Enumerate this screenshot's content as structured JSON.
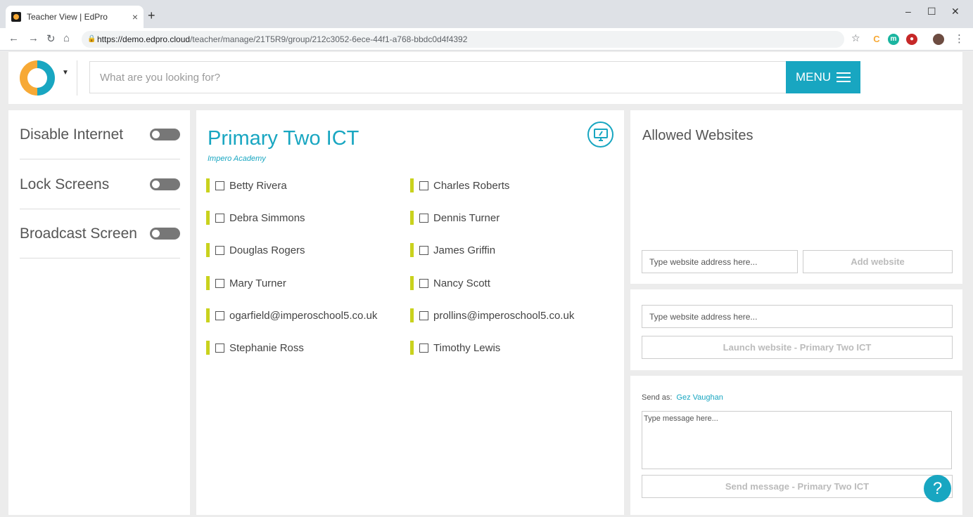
{
  "browser": {
    "tab_title": "Teacher View | EdPro",
    "tab_close": "×",
    "new_tab": "+",
    "url_domain": "https://demo.edpro.cloud",
    "url_path": "/teacher/manage/21T5R9/group/212c3052-6ece-44f1-a768-bbdc0d4f4392",
    "window_minimize": "–",
    "window_maximize": "☐",
    "window_close": "✕"
  },
  "header": {
    "search_placeholder": "What are you looking for?",
    "menu_label": "MENU"
  },
  "controls": [
    {
      "label": "Disable Internet",
      "on": false
    },
    {
      "label": "Lock Screens",
      "on": false
    },
    {
      "label": "Broadcast Screen",
      "on": false
    }
  ],
  "group": {
    "title": "Primary Two ICT",
    "school": "Impero Academy",
    "students": [
      "Betty Rivera",
      "Charles Roberts",
      "Debra Simmons",
      "Dennis Turner",
      "Douglas Rogers",
      "James Griffin",
      "Mary Turner",
      "Nancy Scott",
      "ogarfield@imperoschool5.co.uk",
      "prollins@imperoschool5.co.uk",
      "Stephanie Ross",
      "Timothy Lewis"
    ]
  },
  "allowed_websites": {
    "title": "Allowed Websites",
    "input_placeholder": "Type website address here...",
    "add_button": "Add website"
  },
  "launch": {
    "input_placeholder": "Type website address here...",
    "button": "Launch website - Primary Two ICT"
  },
  "message": {
    "send_as_label": "Send as:",
    "sender": "Gez Vaughan",
    "placeholder": "Type message here...",
    "button": "Send message - Primary Two ICT"
  },
  "help_label": "?",
  "colors": {
    "accent": "#18a6c1",
    "logo_orange": "#f7a935",
    "student_bar": "#c9d21d"
  }
}
